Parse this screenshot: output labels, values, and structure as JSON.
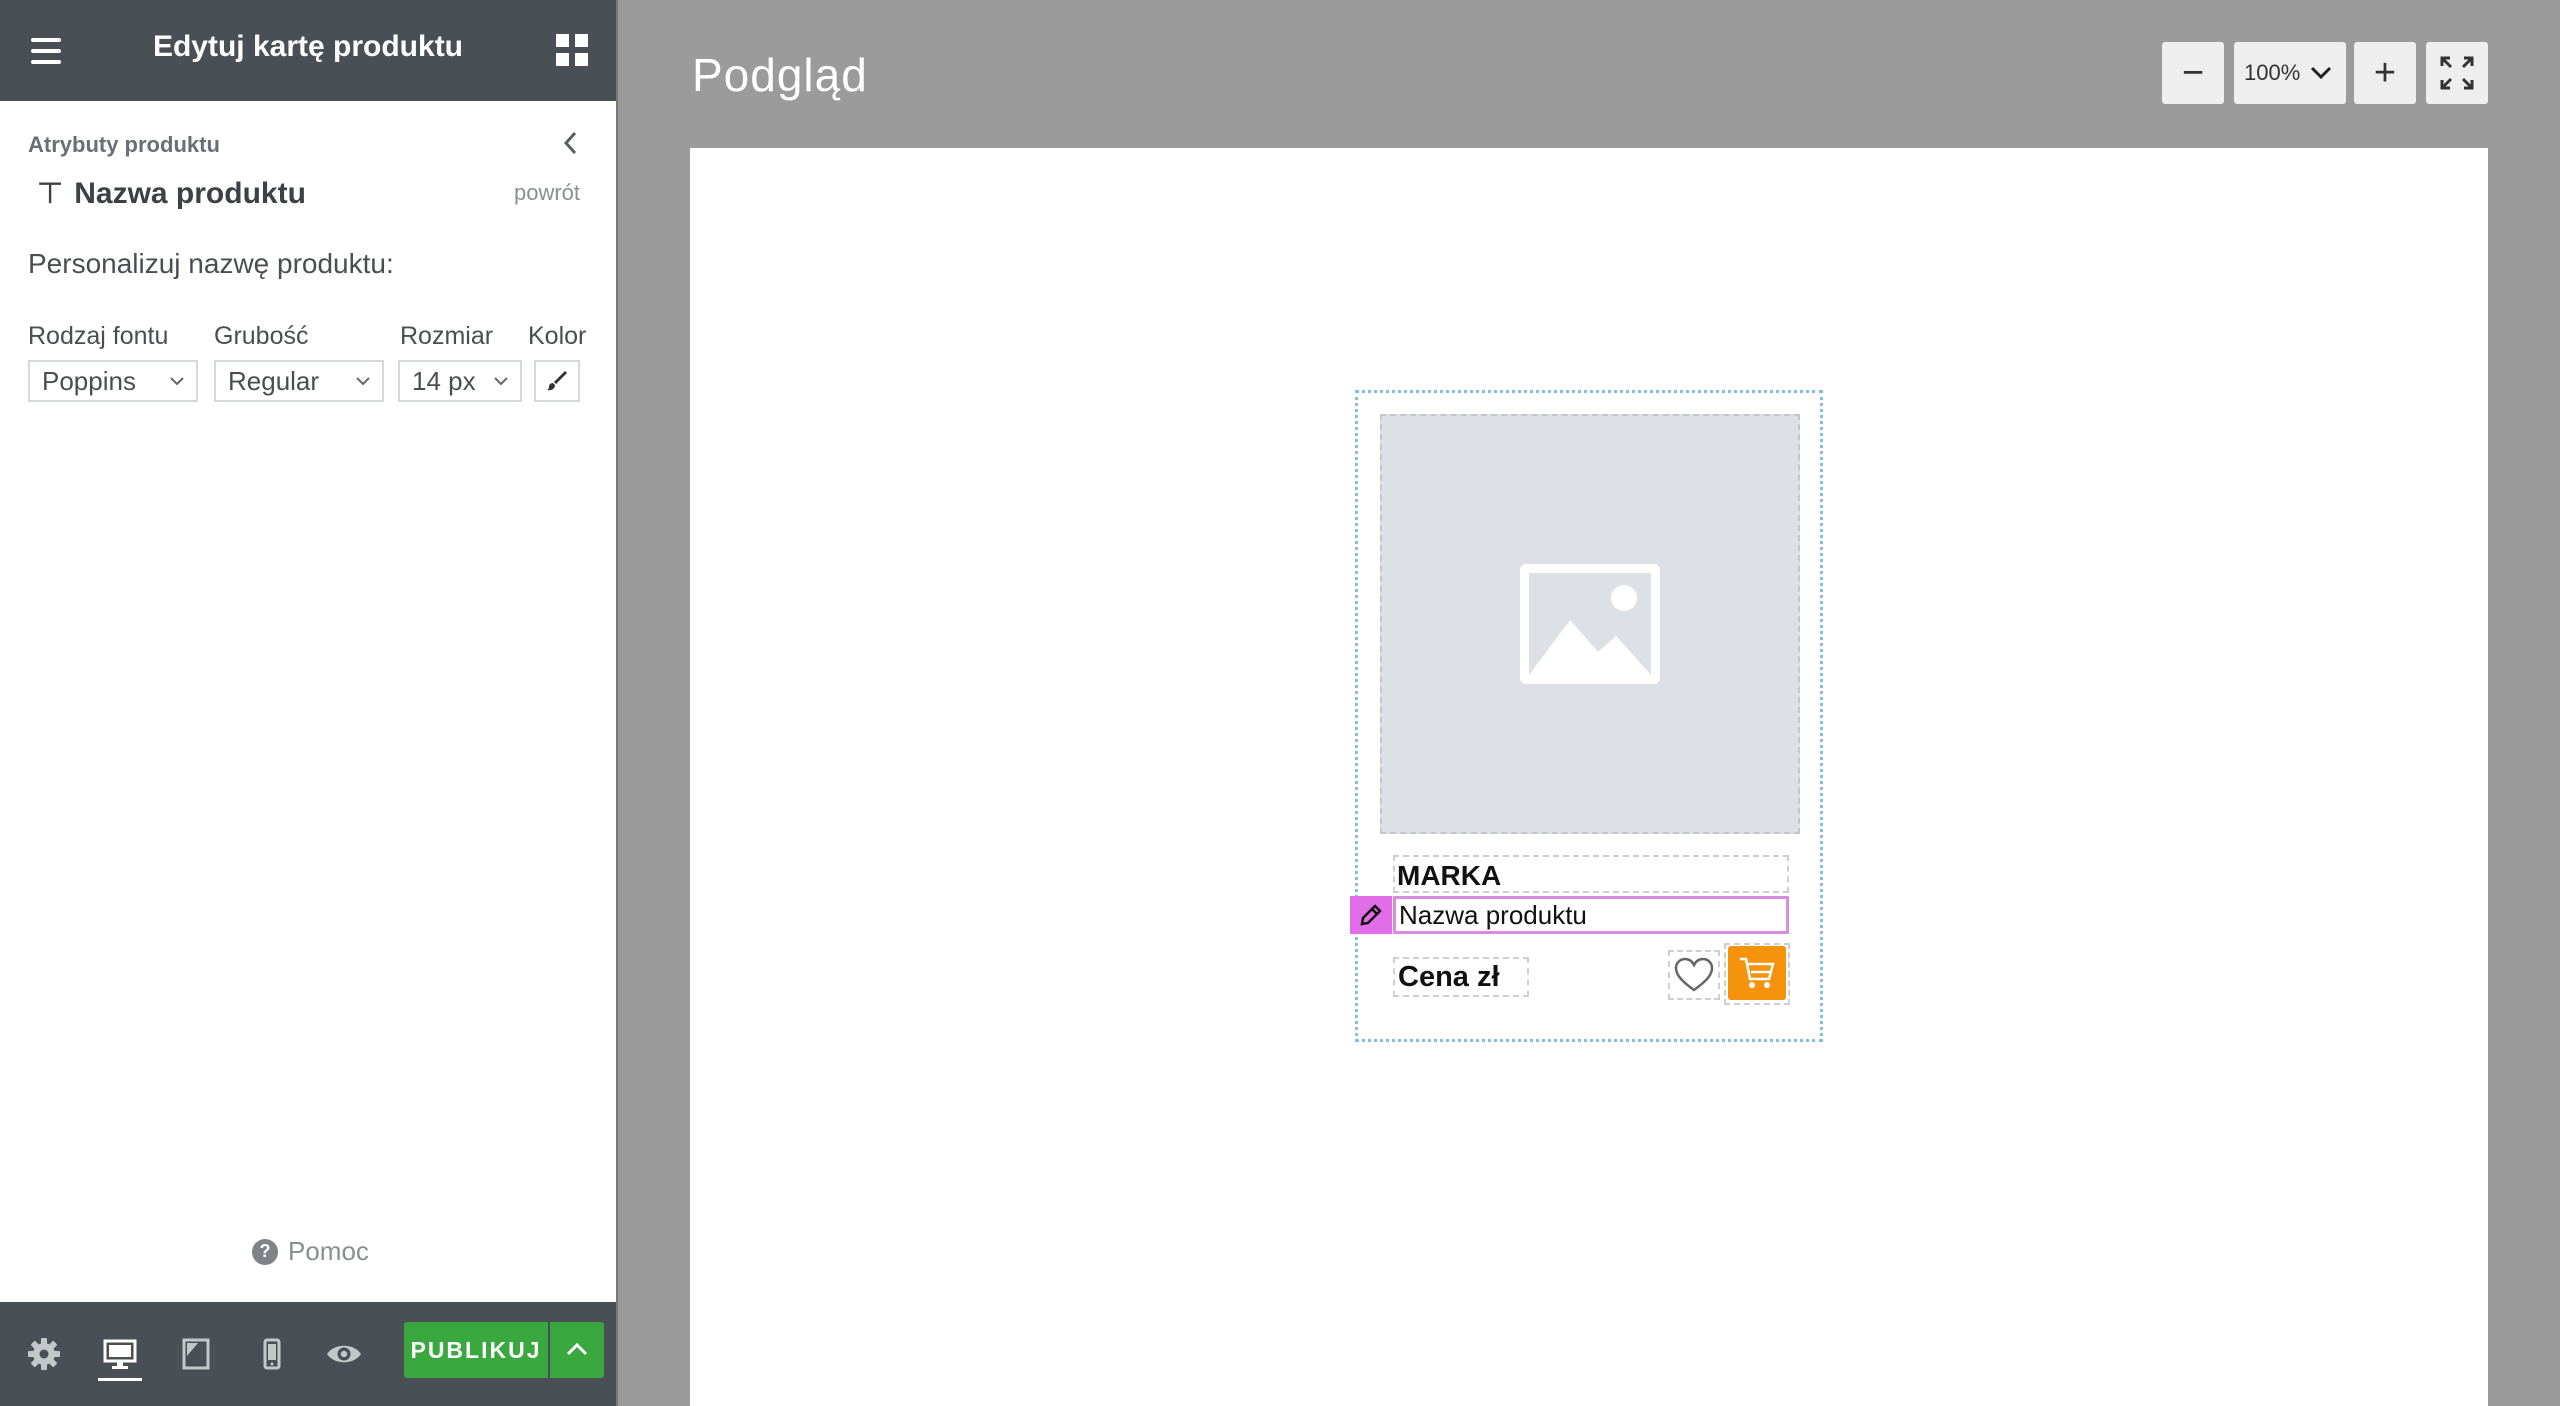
{
  "sidebar": {
    "header": {
      "title": "Edytuj kartę produktu",
      "menu_icon": "hamburger-icon",
      "apps_icon": "grid-icon"
    },
    "breadcrumb": "Atrybuty produktu",
    "section": {
      "title": "Nazwa produktu",
      "icon_glyph": "⊤",
      "back_label": "powrót"
    },
    "customize_label": "Personalizuj nazwę produktu:",
    "controls": {
      "font_family": {
        "label": "Rodzaj fontu",
        "value": "Poppins"
      },
      "font_weight": {
        "label": "Grubość",
        "value": "Regular"
      },
      "font_size": {
        "label": "Rozmiar",
        "value": "14 px"
      },
      "color": {
        "label": "Kolor",
        "icon": "brush-icon"
      }
    },
    "help_label": "Pomoc",
    "help_glyph": "?",
    "footer": {
      "icons": [
        "gear-icon",
        "desktop-icon",
        "tablet-icon",
        "mobile-icon",
        "eye-icon"
      ],
      "active_device": "desktop",
      "publish_label": "PUBLIKUJ"
    }
  },
  "main": {
    "title": "Podgląd",
    "zoom": {
      "value": "100%",
      "decrease_glyph": "−",
      "increase_glyph": "+"
    }
  },
  "preview_card": {
    "brand": "MARKA",
    "name": "Nazwa produktu",
    "price": "Cena zł",
    "image_icon": "image-placeholder-icon",
    "favorite_icon": "heart-icon",
    "cart_icon": "cart-icon"
  },
  "colors": {
    "header_bg": "#4a4f55",
    "publish_green": "#39a83f",
    "cart_orange": "#f5930c",
    "edit_pink": "#e26de8",
    "card_outline": "#7fc3e0"
  }
}
